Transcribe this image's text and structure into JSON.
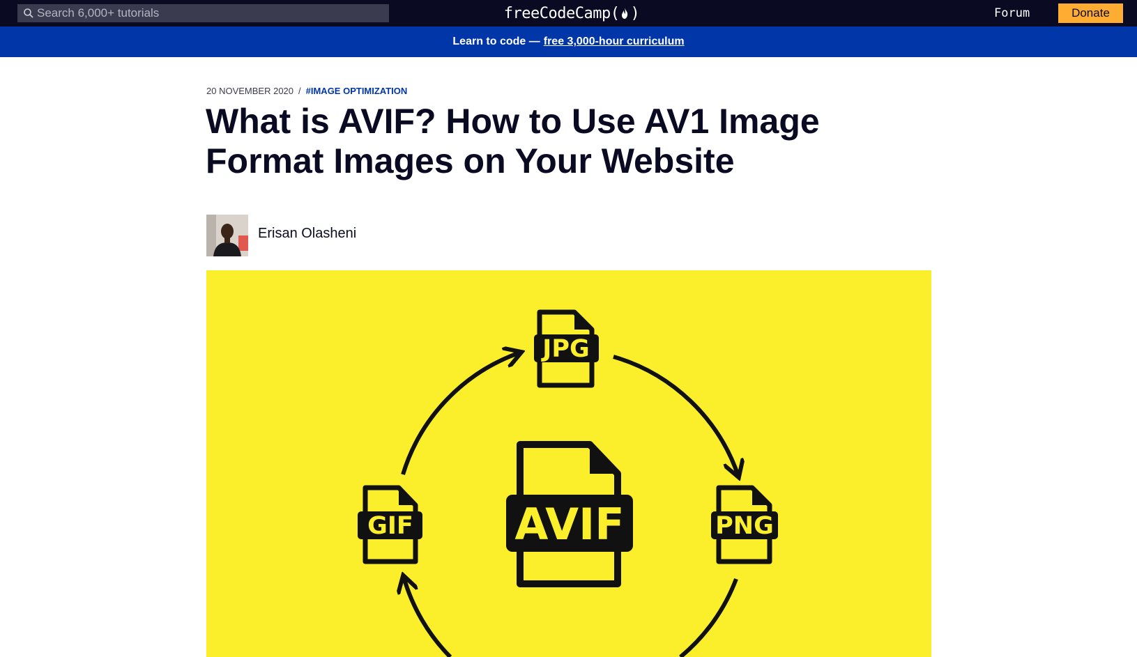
{
  "nav": {
    "search_placeholder": "Search 6,000+ tutorials",
    "logo_left": "freeCodeCamp(",
    "logo_right": ")",
    "forum_label": "Forum",
    "donate_label": "Donate"
  },
  "banner": {
    "text": "Learn to code —",
    "link_text": "free 3,000-hour curriculum"
  },
  "article": {
    "date": "20 November 2020",
    "separator": "/",
    "tag": "#Image Optimization",
    "title": "What is AVIF? How to Use AV1 Image Format Images on Your Website",
    "author": "Erisan Olasheni"
  },
  "feature_image": {
    "center_label": "AVIF",
    "top_label": "JPG",
    "right_label": "PNG",
    "left_label": "GIF"
  },
  "colors": {
    "nav_bg": "#0a0a23",
    "banner_bg": "#0036a8",
    "donate_bg": "#feac32",
    "feature_bg": "#fbee2b"
  }
}
